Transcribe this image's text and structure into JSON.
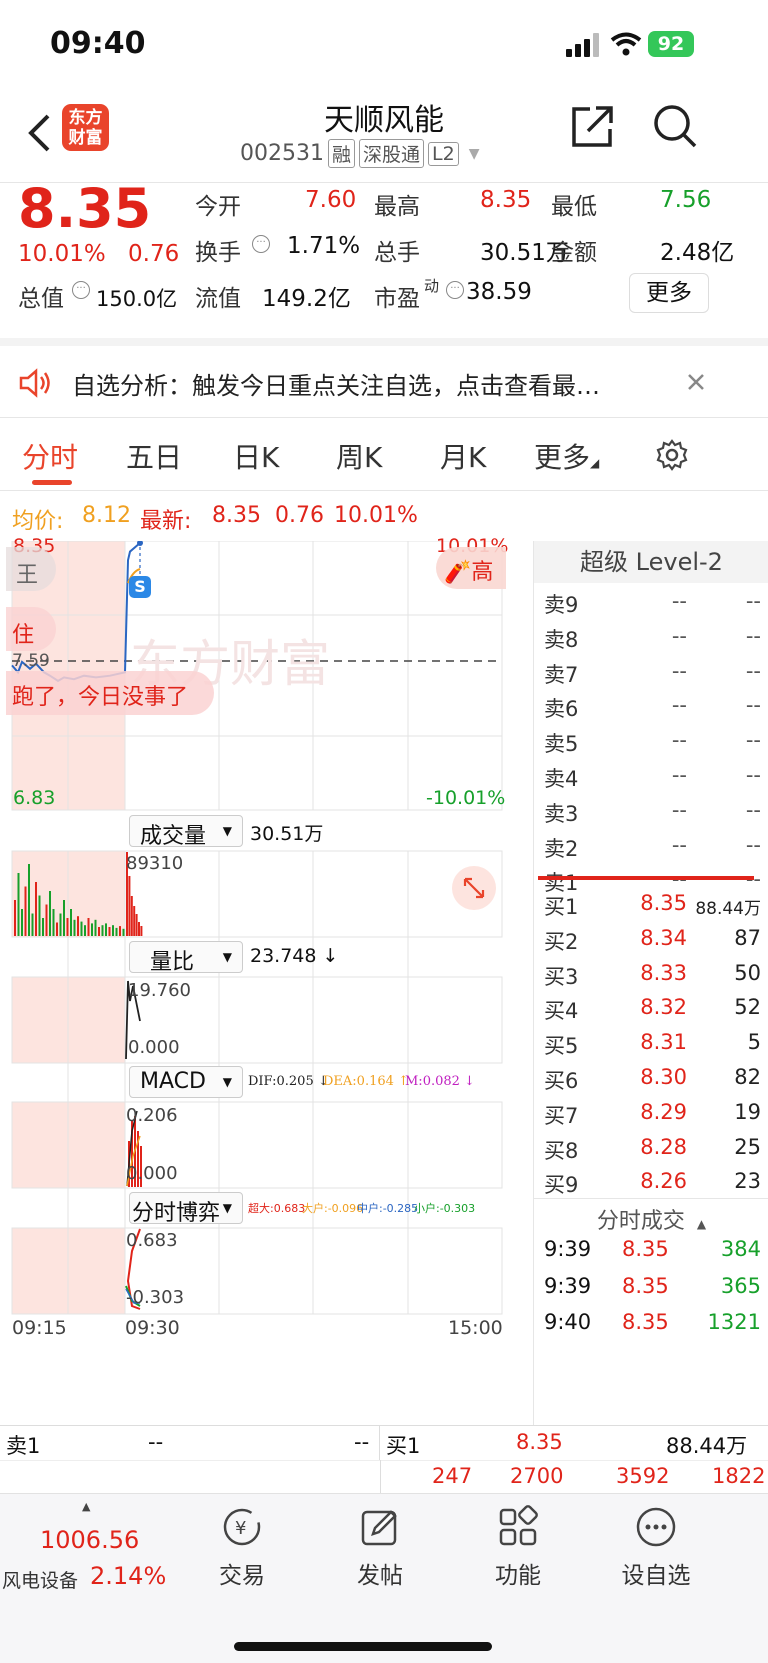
{
  "status": {
    "time": "09:40",
    "battery": "92"
  },
  "header": {
    "logo_line1": "东方",
    "logo_line2": "财富",
    "title": "天顺风能",
    "code": "002531",
    "badges": [
      "融",
      "深股通",
      "L2"
    ]
  },
  "quote": {
    "price": "8.35",
    "change_pct": "10.01%",
    "change": "0.76",
    "metrics": [
      {
        "label": "今开",
        "value": "7.60",
        "color": "#e0241a"
      },
      {
        "label": "最高",
        "value": "8.35",
        "color": "#e0241a"
      },
      {
        "label": "最低",
        "value": "7.56",
        "color": "#17a02b"
      },
      {
        "label": "换手",
        "value": "1.71%",
        "color": "#111111"
      },
      {
        "label": "总手",
        "value": "30.51万",
        "color": "#111111"
      },
      {
        "label": "金额",
        "value": "2.48亿",
        "color": "#111111"
      }
    ],
    "total_value_label": "总值",
    "total_value": "150.0亿",
    "float_value_label": "流值",
    "float_value": "149.2亿",
    "pe_label": "市盈",
    "pe_sup": "动",
    "pe_value": "38.59",
    "more_button": "更多"
  },
  "notice": {
    "text": "自选分析：触发今日重点关注自选，点击查看最…"
  },
  "tabs": [
    "分时",
    "五日",
    "日K",
    "周K",
    "月K",
    "更多"
  ],
  "active_tab": 0,
  "info_line": {
    "avg_label": "均价:",
    "avg_value": "8.12",
    "latest_label": "最新:",
    "latest_value": "8.35",
    "change": "0.76",
    "change_pct": "10.01%"
  },
  "chart": {
    "y_top_left": "8.35",
    "y_top_right": "10.01%",
    "y_bottom_left": "6.83",
    "y_bottom_right": "-10.01%",
    "prev_close_label": "7.59",
    "overlay_text_1": "王",
    "overlay_text_2": "住",
    "overlay_text_3": "跑了，今日没事了",
    "gift_label": "高",
    "watermark": "东方财富",
    "sell_marker": "S",
    "volume_dropdown": "成交量",
    "volume_value": "30.51万",
    "volume_max": "89310",
    "ratio_dropdown": "量比",
    "ratio_value": "23.748 ↓",
    "ratio_max": "19.760",
    "ratio_min": "0.000",
    "macd_dropdown": "MACD",
    "macd_dif": "DIF:0.205 ↓",
    "macd_dea": "DEA:0.164 ↑",
    "macd_m": "M:0.082 ↓",
    "macd_max": "0.206",
    "macd_min": "0.000",
    "game_dropdown": "分时博弈",
    "game_super": "超大:0.683",
    "game_big": "大户:-0.096",
    "game_mid": "中户:-0.285",
    "game_small": "小户:-0.303",
    "game_max": "0.683",
    "game_min": "-0.303",
    "x_labels": [
      "09:15",
      "09:30",
      "15:00"
    ]
  },
  "chart_data": {
    "type": "line",
    "title": "",
    "x": [
      "09:15",
      "09:25",
      "09:30",
      "09:31",
      "09:32",
      "09:35",
      "09:37",
      "09:38",
      "09:39",
      "09:40"
    ],
    "series": [
      {
        "name": "",
        "values": [
          7.64,
          7.58,
          7.6,
          7.56,
          7.58,
          7.57,
          7.6,
          7.6,
          8.25,
          8.35
        ]
      }
    ],
    "ylim": [
      6.83,
      8.35
    ],
    "prev_close": 7.59,
    "xlabel": "",
    "ylabel": ""
  },
  "level2": {
    "title": "超级 Level-2",
    "asks": [
      {
        "label": "卖9",
        "price": "--",
        "vol": "--"
      },
      {
        "label": "卖8",
        "price": "--",
        "vol": "--"
      },
      {
        "label": "卖7",
        "price": "--",
        "vol": "--"
      },
      {
        "label": "卖6",
        "price": "--",
        "vol": "--"
      },
      {
        "label": "卖5",
        "price": "--",
        "vol": "--"
      },
      {
        "label": "卖4",
        "price": "--",
        "vol": "--"
      },
      {
        "label": "卖3",
        "price": "--",
        "vol": "--"
      },
      {
        "label": "卖2",
        "price": "--",
        "vol": "--"
      },
      {
        "label": "卖1",
        "price": "--",
        "vol": "--"
      }
    ],
    "bids": [
      {
        "label": "买1",
        "price": "8.35",
        "vol": "88.44万"
      },
      {
        "label": "买2",
        "price": "8.34",
        "vol": "87"
      },
      {
        "label": "买3",
        "price": "8.33",
        "vol": "50"
      },
      {
        "label": "买4",
        "price": "8.32",
        "vol": "52"
      },
      {
        "label": "买5",
        "price": "8.31",
        "vol": "5"
      },
      {
        "label": "买6",
        "price": "8.30",
        "vol": "82"
      },
      {
        "label": "买7",
        "price": "8.29",
        "vol": "19"
      },
      {
        "label": "买8",
        "price": "8.28",
        "vol": "25"
      },
      {
        "label": "买9",
        "price": "8.26",
        "vol": "23"
      }
    ],
    "ticks_title": "分时成交",
    "ticks": [
      {
        "time": "9:39",
        "price": "8.35",
        "vol": "384"
      },
      {
        "time": "9:39",
        "price": "8.35",
        "vol": "365"
      },
      {
        "time": "9:40",
        "price": "8.35",
        "vol": "1321"
      }
    ]
  },
  "bottombar": {
    "sell_label": "卖1",
    "sell_price": "--",
    "sell_vol": "--",
    "buy_label": "买1",
    "buy_price": "8.35",
    "buy_vol": "88.44万",
    "queue": [
      "247",
      "2700",
      "3592",
      "1822"
    ]
  },
  "nav": {
    "index_value": "1006.56",
    "index_name": "风电设备",
    "index_change": "2.14%",
    "items": [
      "交易",
      "发帖",
      "功能",
      "设自选"
    ]
  }
}
